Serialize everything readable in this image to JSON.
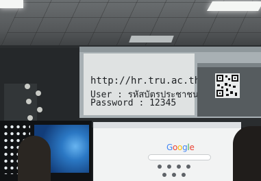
{
  "projected_slide": {
    "url_line": "http://hr.tru.ac.th",
    "user_line": "User : รหัสบัตรประชาชน",
    "password_line": "Password : 12345"
  },
  "browser_monitor": {
    "logo_letters": [
      {
        "char": "G",
        "color": "#4285f4"
      },
      {
        "char": "o",
        "color": "#ea4335"
      },
      {
        "char": "o",
        "color": "#fbbc05"
      },
      {
        "char": "g",
        "color": "#4285f4"
      },
      {
        "char": "l",
        "color": "#34a853"
      },
      {
        "char": "e",
        "color": "#ea4335"
      }
    ]
  }
}
